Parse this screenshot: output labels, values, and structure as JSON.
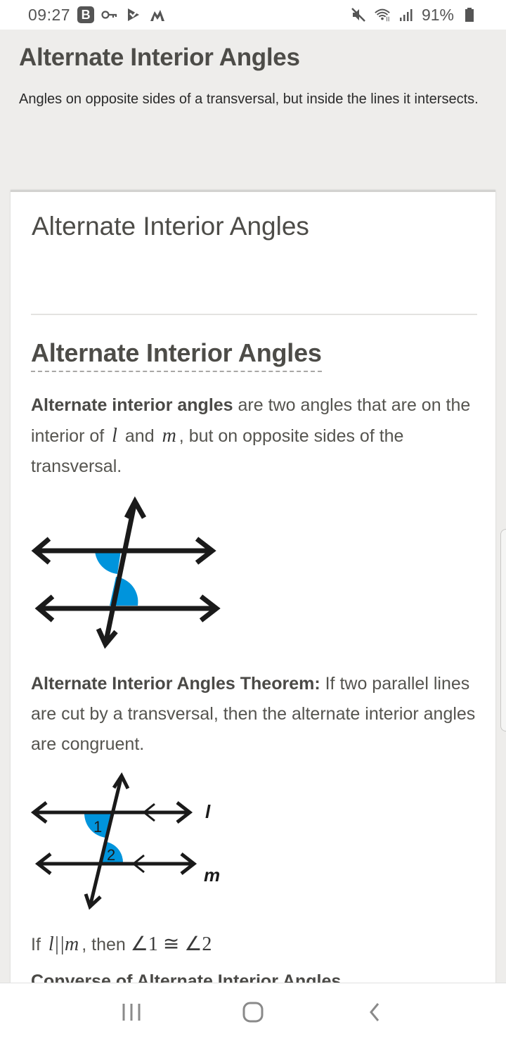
{
  "status_bar": {
    "time": "09:27",
    "left_icons": [
      "b-app-icon",
      "key-icon",
      "check-flag-icon",
      "mountain-icon"
    ],
    "right_icons": [
      "mute-icon",
      "wifi-icon",
      "signal-icon"
    ],
    "battery_percent": "91%"
  },
  "header": {
    "title": "Alternate Interior Angles",
    "subtitle": "Angles on opposite sides of a transversal, but inside the lines it intersects."
  },
  "card": {
    "title": "Alternate Interior Angles",
    "section_heading": "Alternate Interior Angles",
    "definition": {
      "term": "Alternate interior angles",
      "text_a": " are two angles that are on the interior of ",
      "var_l": "l",
      "text_b": " and ",
      "var_m": "m",
      "text_c": ", but on opposite sides of the transversal."
    },
    "theorem": {
      "label": "Alternate Interior Angles Theorem:",
      "text": " If two parallel lines are cut by a transversal, then the alternate interior angles are congruent."
    },
    "statement": {
      "prefix": "If ",
      "math_condition": "l||m",
      "middle": ", then ",
      "math_result": "∠1 ≅ ∠2"
    },
    "next_heading_partial": "Converse of Alternate Interior Angles",
    "diagram2_labels": {
      "line_top": "l",
      "line_bottom": "m",
      "angle_1": "1",
      "angle_2": "2"
    },
    "accent_color": "#0094dc"
  },
  "nav_bar": {
    "buttons": [
      "recent-apps",
      "home",
      "back"
    ]
  }
}
